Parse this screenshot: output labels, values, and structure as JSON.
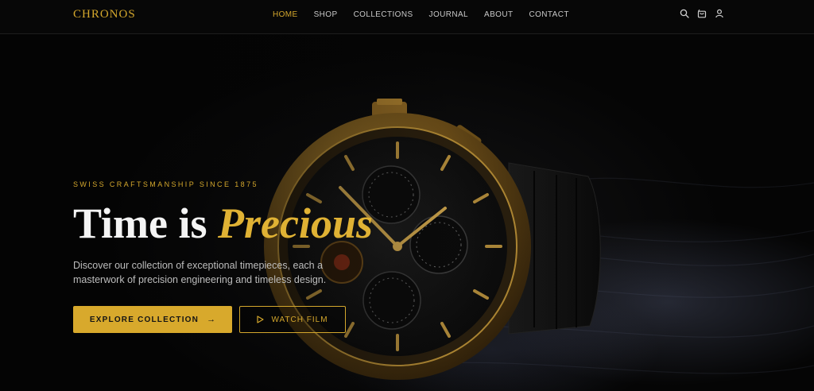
{
  "brand": {
    "name": "CHRONOS"
  },
  "nav": {
    "items": [
      {
        "label": "HOME",
        "active": true
      },
      {
        "label": "SHOP",
        "active": false
      },
      {
        "label": "COLLECTIONS",
        "active": false
      },
      {
        "label": "JOURNAL",
        "active": false
      },
      {
        "label": "ABOUT",
        "active": false
      },
      {
        "label": "CONTACT",
        "active": false
      }
    ],
    "icons": [
      "search-icon",
      "cart-icon",
      "user-icon"
    ]
  },
  "hero": {
    "eyebrow": "SWISS CRAFTSMANSHIP SINCE 1875",
    "headline_plain": "Time is",
    "headline_accent": "Precious",
    "subtext": "Discover our collection of exceptional timepieces, each a masterwork of precision engineering and timeless design.",
    "primary_button": {
      "label": "EXPLORE COLLECTION",
      "icon": "arrow-right-icon"
    },
    "secondary_button": {
      "label": "WATCH FILM",
      "icon": "play-icon"
    }
  },
  "colors": {
    "accent_gold": "#d4a72c",
    "background": "#060606",
    "text_light": "#f4f4f4"
  }
}
